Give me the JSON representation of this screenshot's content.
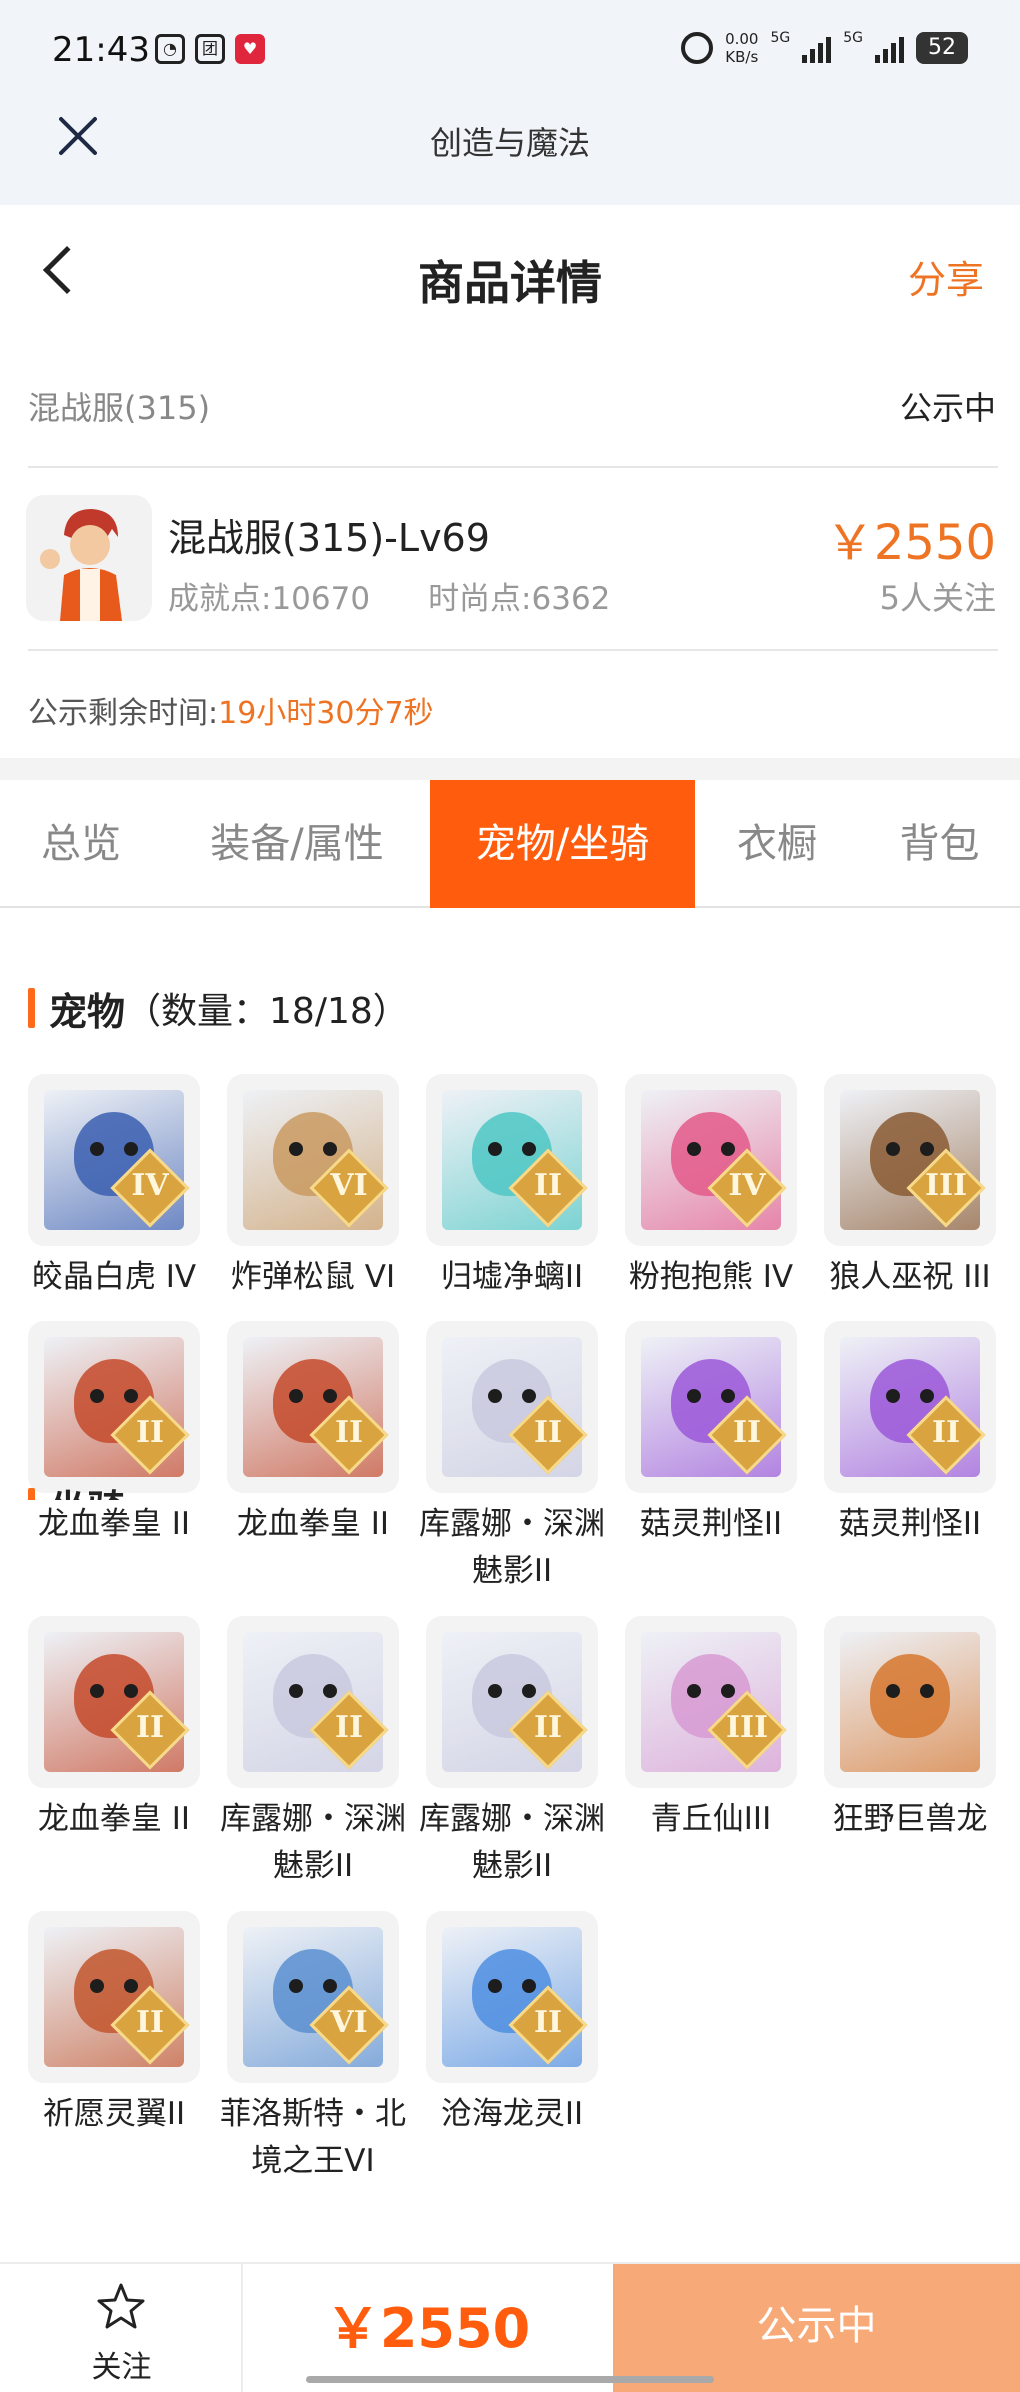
{
  "status_bar": {
    "time": "21:43",
    "net_speed_value": "0.00",
    "net_speed_unit": "KB/s",
    "signal1": "5G",
    "signal2": "5G",
    "battery": "52",
    "left_icons": [
      "qq-icon",
      "meituan-icon",
      "heart-app-icon"
    ]
  },
  "app_bar": {
    "title": "创造与魔法"
  },
  "nav": {
    "title": "商品详情",
    "share_label": "分享"
  },
  "listing": {
    "server": "混战服(315)",
    "status": "公示中",
    "title": "混战服(315)-Lv69",
    "achievement": "成就点:10670",
    "fashion": "时尚点:6362",
    "price": "￥2550",
    "followers": "5人关注",
    "countdown_label": "公示剩余时间:",
    "countdown_value": "19小时30分7秒"
  },
  "tabs": [
    {
      "label": "总览",
      "active": false
    },
    {
      "label": "装备/属性",
      "active": false
    },
    {
      "label": "宠物/坐骑",
      "active": true
    },
    {
      "label": "衣橱",
      "active": false
    },
    {
      "label": "背包",
      "active": false
    }
  ],
  "pets_section": {
    "title": "宠物",
    "count": "（数量：18/18）"
  },
  "pets": [
    {
      "name": "皎晶白虎 IV",
      "rank": "IV",
      "color": "#3b5fb0"
    },
    {
      "name": "炸弹松鼠 VI",
      "rank": "VI",
      "color": "#c99a62"
    },
    {
      "name": "归墟净螭II",
      "rank": "II",
      "color": "#4fc7c4"
    },
    {
      "name": "粉抱抱熊 IV",
      "rank": "IV",
      "color": "#e35a8a"
    },
    {
      "name": "狼人巫祝 III",
      "rank": "III",
      "color": "#8a5b34"
    },
    {
      "name": "龙血拳皇 II",
      "rank": "II",
      "color": "#c44a2c"
    },
    {
      "name": "龙血拳皇 II",
      "rank": "II",
      "color": "#c44a2c"
    },
    {
      "name": "库露娜・深渊魅影II",
      "rank": "II",
      "color": "#c9c9df"
    },
    {
      "name": "菇灵荆怪II",
      "rank": "II",
      "color": "#9b58d8"
    },
    {
      "name": "菇灵荆怪II",
      "rank": "II",
      "color": "#9b58d8"
    },
    {
      "name": "龙血拳皇 II",
      "rank": "II",
      "color": "#c44a2c"
    },
    {
      "name": "库露娜・深渊魅影II",
      "rank": "II",
      "color": "#c9c9df"
    },
    {
      "name": "库露娜・深渊魅影II",
      "rank": "II",
      "color": "#c9c9df"
    },
    {
      "name": "青丘仙III",
      "rank": "III",
      "color": "#d79ad2"
    },
    {
      "name": "狂野巨兽龙",
      "rank": "",
      "color": "#d6772f"
    },
    {
      "name": "祈愿灵翼II",
      "rank": "II",
      "color": "#c2562e"
    },
    {
      "name": "菲洛斯特・北境之王VI",
      "rank": "VI",
      "color": "#5b8fd0"
    },
    {
      "name": "沧海龙灵II",
      "rank": "II",
      "color": "#4f8ee0"
    }
  ],
  "mounts_section": {
    "title": "坐骑"
  },
  "bottom_bar": {
    "follow_label": "关注",
    "price": "￥2550",
    "status_button": "公示中"
  },
  "colors": {
    "accent": "#ff5d0d",
    "price": "#ee7424",
    "status_button": "#f7a978"
  }
}
